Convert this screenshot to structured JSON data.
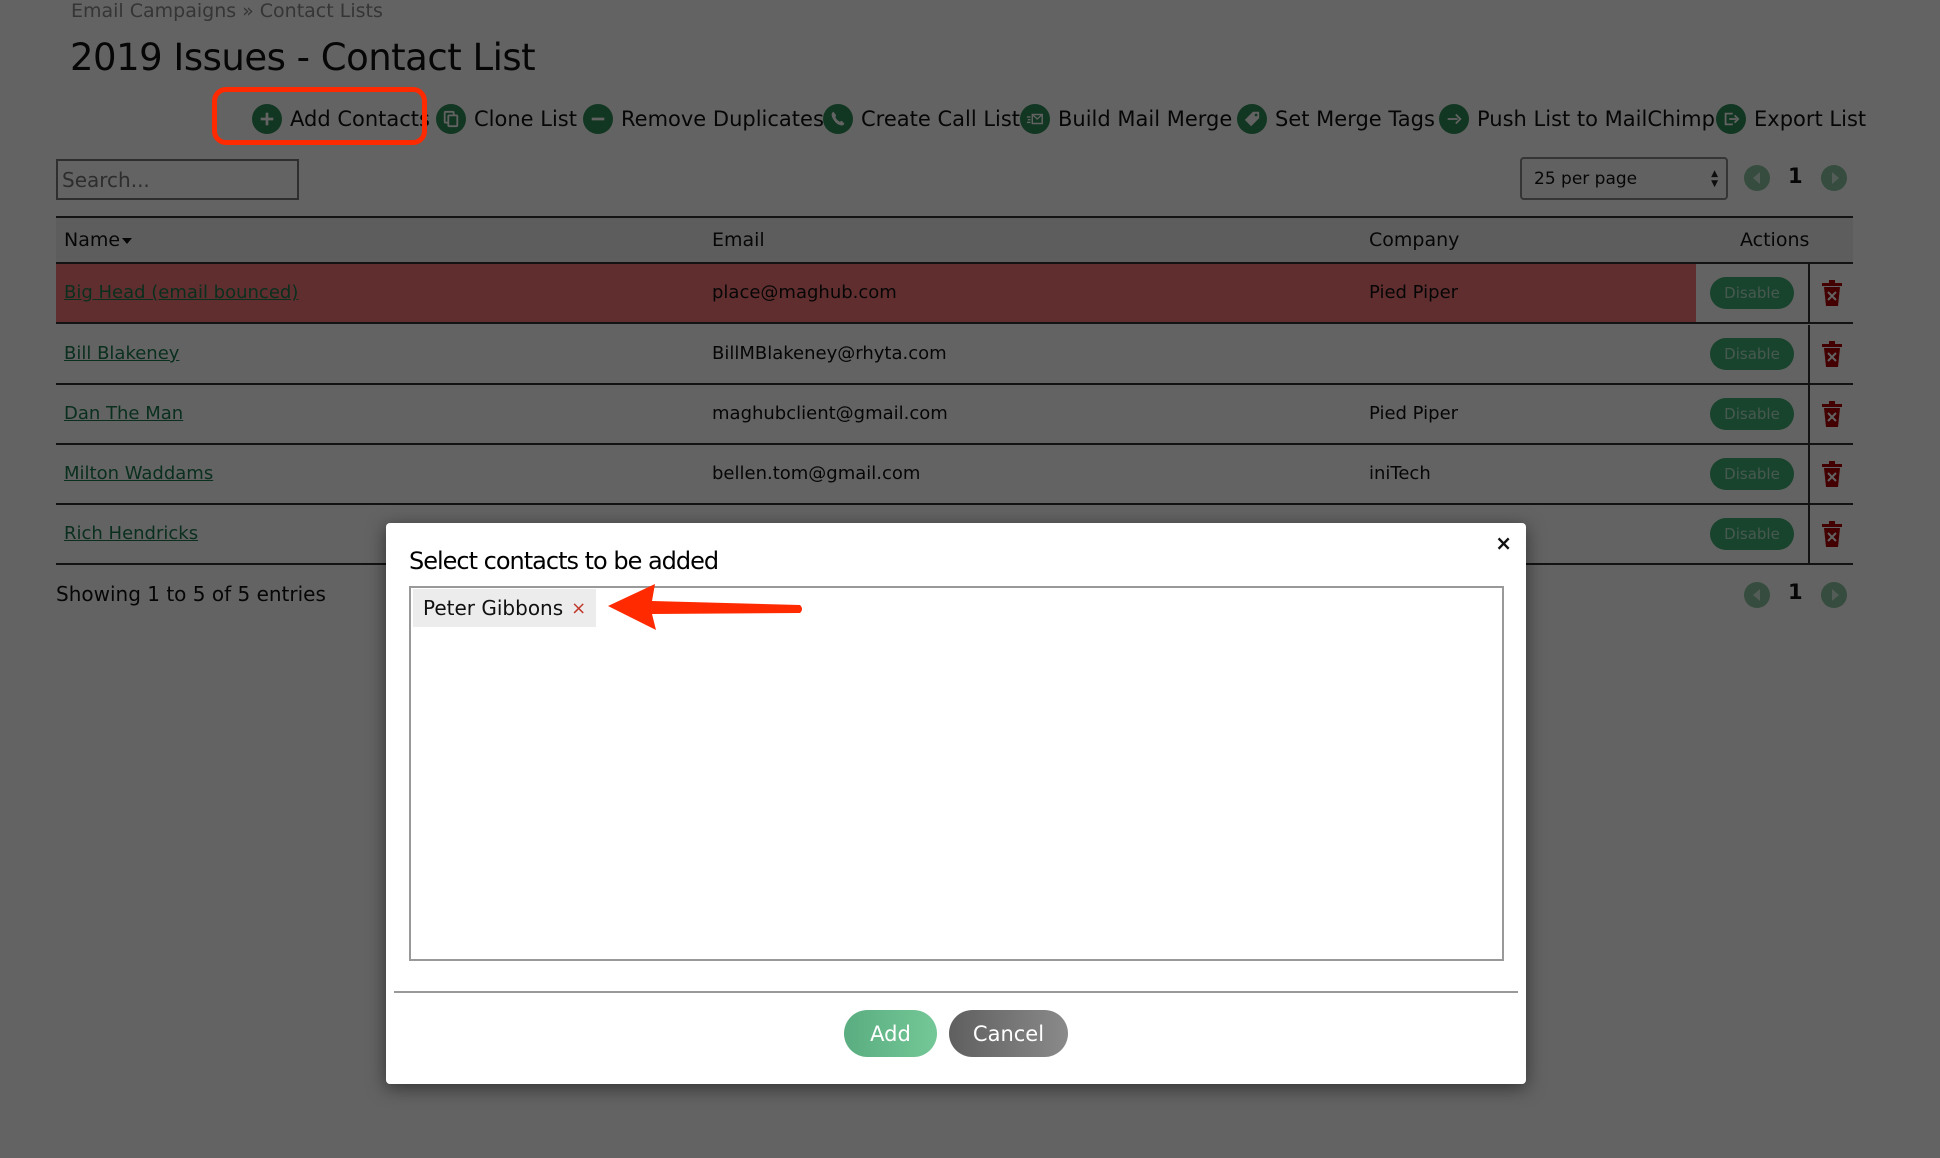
{
  "breadcrumb": {
    "parent": "Email Campaigns",
    "separator": "»",
    "current": "Contact Lists"
  },
  "page_title": "2019 Issues - Contact List",
  "toolbar": [
    {
      "label": "Add Contacts",
      "icon": "plus-circle-icon"
    },
    {
      "label": "Clone List",
      "icon": "copy-icon"
    },
    {
      "label": "Remove Duplicates",
      "icon": "minus-circle-icon"
    },
    {
      "label": "Create Call List",
      "icon": "phone-icon"
    },
    {
      "label": "Build Mail Merge",
      "icon": "mail-merge-icon"
    },
    {
      "label": "Set Merge Tags",
      "icon": "tag-icon"
    },
    {
      "label": "Push List to MailChimp",
      "icon": "arrow-right-icon"
    },
    {
      "label": "Export List",
      "icon": "export-icon"
    }
  ],
  "search": {
    "placeholder": "Search...",
    "value": ""
  },
  "per_page": {
    "selected": "25 per page"
  },
  "pagination": {
    "current_page": "1"
  },
  "table": {
    "headers": {
      "name": "Name",
      "email": "Email",
      "company": "Company",
      "actions": "Actions"
    },
    "sort_column": "Name",
    "rows": [
      {
        "name": "Big Head (email bounced)",
        "email": "place@maghub.com",
        "company": "Pied Piper",
        "bounced": true,
        "action": "Disable"
      },
      {
        "name": "Bill Blakeney",
        "email": "BillMBlakeney@rhyta.com",
        "company": "",
        "bounced": false,
        "action": "Disable"
      },
      {
        "name": "Dan The Man",
        "email": "maghubclient@gmail.com",
        "company": "Pied Piper",
        "bounced": false,
        "action": "Disable"
      },
      {
        "name": "Milton Waddams",
        "email": "bellen.tom@gmail.com",
        "company": "iniTech",
        "bounced": false,
        "action": "Disable"
      },
      {
        "name": "Rich Hendricks",
        "email": "",
        "company": "",
        "bounced": false,
        "action": "Disable"
      }
    ]
  },
  "footer": {
    "showing": "Showing 1 to 5 of 5 entries"
  },
  "modal": {
    "title": "Select contacts to be added",
    "close": "×",
    "selected_tags": [
      {
        "label": "Peter Gibbons",
        "remove": "×"
      }
    ],
    "add_label": "Add",
    "cancel_label": "Cancel"
  },
  "colors": {
    "accent_green": "#2e8b57",
    "bounced_row": "#f8787a",
    "annotation_red": "#ff2a00",
    "delete_red": "#b00000"
  }
}
